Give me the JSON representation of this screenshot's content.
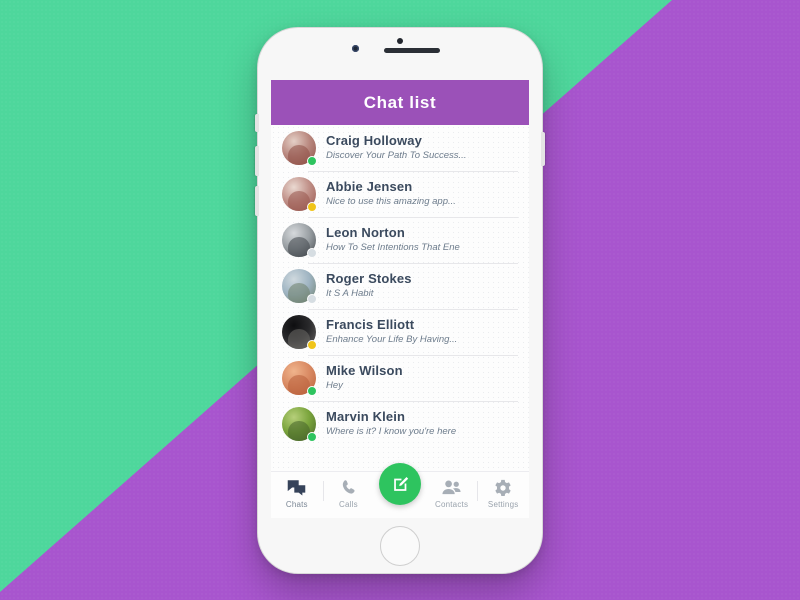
{
  "background": {
    "green": "#4ed79c",
    "purple": "#a855ce"
  },
  "device": {
    "name": "smartphone-mockup",
    "body_color": "#f7f7f7"
  },
  "app": {
    "header": {
      "title": "Chat list",
      "background": "#9b51b8",
      "text_color": "#ffffff"
    },
    "chats": [
      {
        "name": "Craig Holloway",
        "preview": "Discover Your Path To Success...",
        "status": "online",
        "status_color": "#2ec45f",
        "avatar_colors": [
          "#b9887f",
          "#8e4f46",
          "#e4cfc6"
        ]
      },
      {
        "name": "Abbie Jensen",
        "preview": "Nice to use this amazing app...",
        "status": "away",
        "status_color": "#f0c419",
        "avatar_colors": [
          "#c09088",
          "#97554c",
          "#ead9d1"
        ]
      },
      {
        "name": "Leon Norton",
        "preview": "How To Set Intentions That Ene",
        "status": "offline",
        "status_color": "#d6dde2",
        "avatar_colors": [
          "#9aa0a4",
          "#40454a",
          "#d6d9dc"
        ]
      },
      {
        "name": "Roger Stokes",
        "preview": "It S A Habit",
        "status": "offline",
        "status_color": "#d6dde2",
        "avatar_colors": [
          "#9fb4c2",
          "#6d7f6a",
          "#cfd9de"
        ]
      },
      {
        "name": "Francis Elliott",
        "preview": "Enhance Your Life By Having...",
        "status": "away",
        "status_color": "#f0c419",
        "avatar_colors": [
          "#2a2a2c",
          "#6e6b68",
          "#0e0e10"
        ]
      },
      {
        "name": "Mike Wilson",
        "preview": "Hey",
        "status": "online",
        "status_color": "#2ec45f",
        "avatar_colors": [
          "#d98a63",
          "#b85f3a",
          "#f0b48c"
        ]
      },
      {
        "name": "Marvin Klein",
        "preview": "Where is it? I know you're here",
        "status": "online",
        "status_color": "#2ec45f",
        "avatar_colors": [
          "#7aa43c",
          "#46622a",
          "#b6cf7a"
        ]
      }
    ],
    "bottom_nav": {
      "items": [
        {
          "label": "Chats",
          "icon": "chat-bubbles-icon",
          "active": true
        },
        {
          "label": "Calls",
          "icon": "phone-handset-icon",
          "active": false
        },
        {
          "label": "",
          "icon": "compose-icon",
          "active": false
        },
        {
          "label": "Contacts",
          "icon": "people-icon",
          "active": false
        },
        {
          "label": "Settings",
          "icon": "gear-icon",
          "active": false
        }
      ],
      "fab": {
        "icon": "compose-pencil-icon",
        "color": "#2ec45f"
      }
    }
  }
}
